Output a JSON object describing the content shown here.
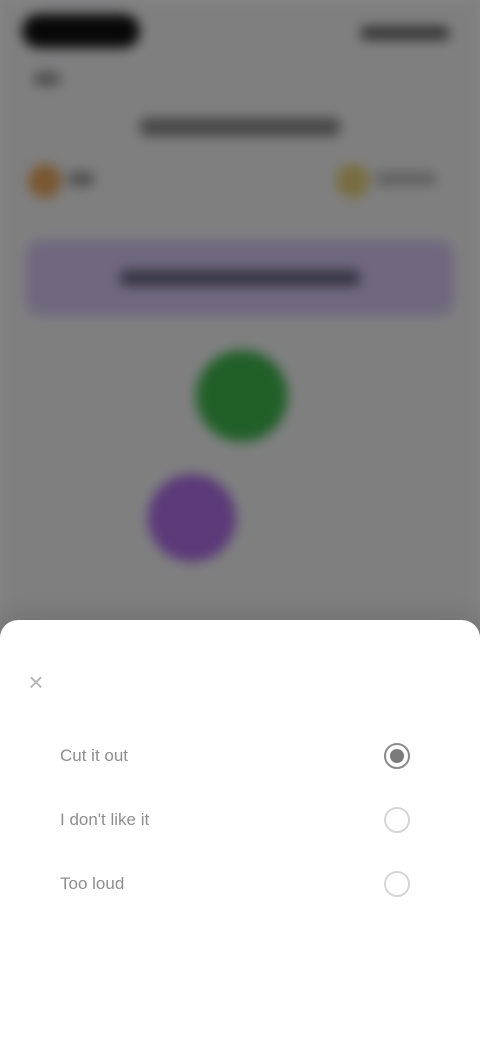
{
  "sheet": {
    "close_icon": "close-icon",
    "options": [
      {
        "label": "Cut it out",
        "selected": true
      },
      {
        "label": "I don't like it",
        "selected": false
      },
      {
        "label": "Too loud",
        "selected": false
      }
    ]
  },
  "background": {
    "accent_green": "#3fb84c",
    "accent_purple": "#b06ee8",
    "banner_color": "#d8c6f2"
  }
}
